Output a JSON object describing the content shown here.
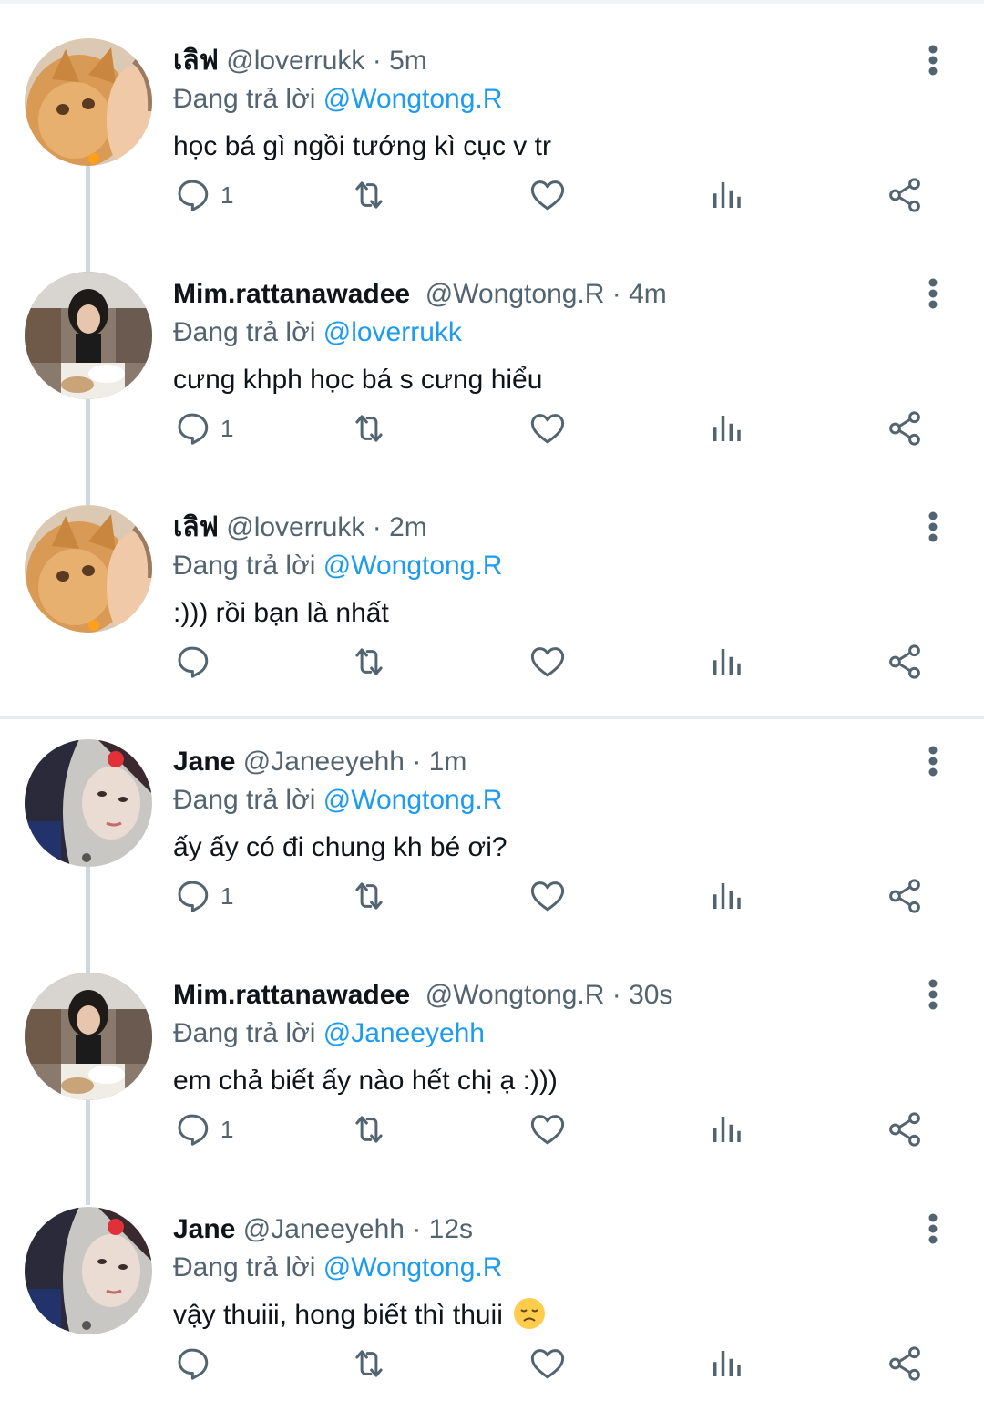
{
  "colors": {
    "link": "#1d9bf0",
    "muted": "#536471",
    "icon": "#536471",
    "text": "#0f1419"
  },
  "tweets": [
    {
      "name": "เลิฟ",
      "handle": "@loverrukk",
      "time": "5m",
      "replying_label": "Đang trả lời",
      "reply_to": "@Wongtong.R",
      "text": "học bá gì ngồi tướng kì cục v tr",
      "reply_count": "1",
      "avatar": "cat-avatar"
    },
    {
      "name": "Mim.rattanawadee",
      "handle": "@Wongtong.R",
      "time": "4m",
      "replying_label": "Đang trả lời",
      "reply_to": "@loverrukk",
      "text": "cưng khph học bá s cưng hiểu",
      "reply_count": "1",
      "avatar": "girl-glasses-avatar"
    },
    {
      "name": "เลิฟ",
      "handle": "@loverrukk",
      "time": "2m",
      "replying_label": "Đang trả lời",
      "reply_to": "@Wongtong.R",
      "text": ":))) rồi bạn là nhất",
      "reply_count": "",
      "avatar": "cat-avatar"
    },
    {
      "name": "Jane",
      "handle": "@Janeeyehh",
      "time": "1m",
      "replying_label": "Đang trả lời",
      "reply_to": "@Wongtong.R",
      "text": "ấy ấy có đi chung kh bé ơi?",
      "reply_count": "1",
      "avatar": "girl-flower-avatar"
    },
    {
      "name": "Mim.rattanawadee",
      "handle": "@Wongtong.R",
      "time": "30s",
      "replying_label": "Đang trả lời",
      "reply_to": "@Janeeyehh",
      "text": "em chả biết ấy nào hết chị ạ :)))",
      "reply_count": "1",
      "avatar": "girl-glasses-avatar"
    },
    {
      "name": "Jane",
      "handle": "@Janeeyehh",
      "time": "12s",
      "replying_label": "Đang trả lời",
      "reply_to": "@Wongtong.R",
      "text": "vậy thuiii, hong biết thì thuii",
      "emoji": "disappointed-face",
      "reply_count": "",
      "avatar": "girl-flower-avatar"
    }
  ]
}
